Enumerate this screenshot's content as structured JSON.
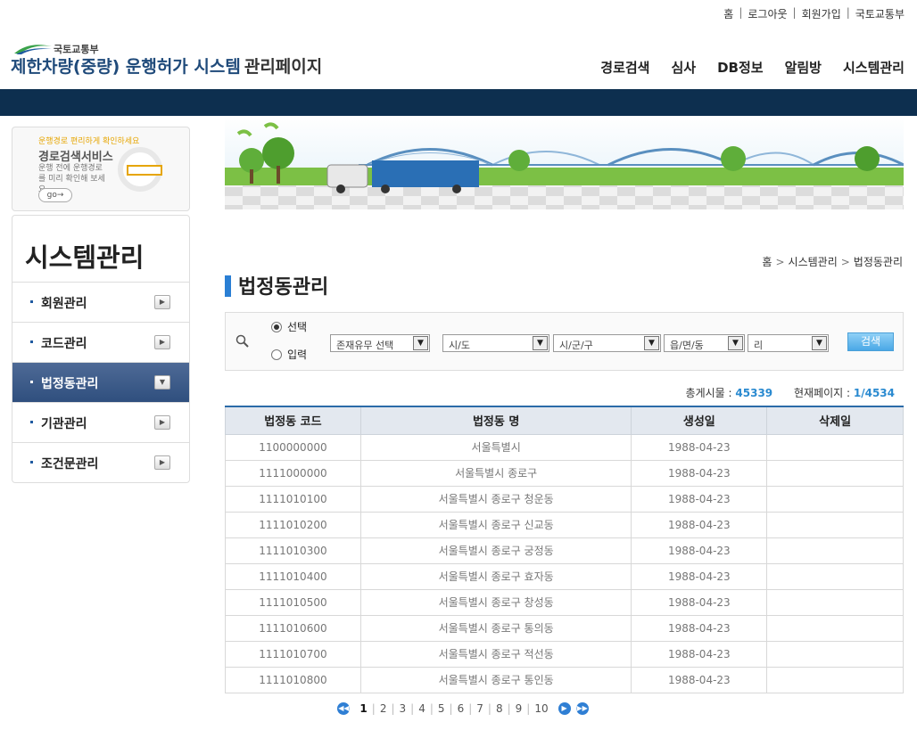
{
  "util_links": [
    "홈",
    "로그아웃",
    "회원가입",
    "국토교통부"
  ],
  "logo": {
    "ministry": "국토교통부",
    "title": "제한차량(중량) 운행허가 시스템",
    "subtitle": "관리페이지"
  },
  "gnb": [
    "경로검색",
    "심사",
    "DB정보",
    "알림방",
    "시스템관리"
  ],
  "promo": {
    "line1": "운행경로 편리하게 확인하세요",
    "line2": "경로검색서비스",
    "line3": "운행 전에 운행경로를 미리 확인해 보세요.",
    "go": "go"
  },
  "leftmenu": {
    "title": "시스템관리",
    "items": [
      {
        "label": "회원관리",
        "active": false
      },
      {
        "label": "코드관리",
        "active": false
      },
      {
        "label": "법정동관리",
        "active": true
      },
      {
        "label": "기관관리",
        "active": false
      },
      {
        "label": "조건문관리",
        "active": false
      }
    ]
  },
  "breadcrumb": [
    "홈",
    "시스템관리",
    "법정동관리"
  ],
  "heading": "법정동관리",
  "search": {
    "radio_select": "선택",
    "radio_input": "입력",
    "selected_radio": "선택",
    "exist_select": "존재유무 선택",
    "sido": "시/도",
    "sigungu": "시/군/구",
    "eupmyeondong": "읍/면/동",
    "ri": "리",
    "button": "검색"
  },
  "count": {
    "total_label": "총게시물 :",
    "total": "45339",
    "page_label": "현재페이지 :",
    "page": "1/4534"
  },
  "table": {
    "headers": [
      "법정동 코드",
      "법정동 명",
      "생성일",
      "삭제일"
    ],
    "rows": [
      [
        "1100000000",
        "서울특별시",
        "1988-04-23",
        ""
      ],
      [
        "1111000000",
        "서울특별시 종로구",
        "1988-04-23",
        ""
      ],
      [
        "1111010100",
        "서울특별시 종로구 청운동",
        "1988-04-23",
        ""
      ],
      [
        "1111010200",
        "서울특별시 종로구 신교동",
        "1988-04-23",
        ""
      ],
      [
        "1111010300",
        "서울특별시 종로구 궁정동",
        "1988-04-23",
        ""
      ],
      [
        "1111010400",
        "서울특별시 종로구 효자동",
        "1988-04-23",
        ""
      ],
      [
        "1111010500",
        "서울특별시 종로구 창성동",
        "1988-04-23",
        ""
      ],
      [
        "1111010600",
        "서울특별시 종로구 통의동",
        "1988-04-23",
        ""
      ],
      [
        "1111010700",
        "서울특별시 종로구 적선동",
        "1988-04-23",
        ""
      ],
      [
        "1111010800",
        "서울특별시 종로구 통인동",
        "1988-04-23",
        ""
      ]
    ]
  },
  "pager": {
    "pages": [
      "1",
      "2",
      "3",
      "4",
      "5",
      "6",
      "7",
      "8",
      "9",
      "10"
    ],
    "current": "1"
  },
  "colors": {
    "navbar": "#0d2f4f",
    "accent": "#2a7fd4",
    "active_menu": "#3a5a8a"
  }
}
